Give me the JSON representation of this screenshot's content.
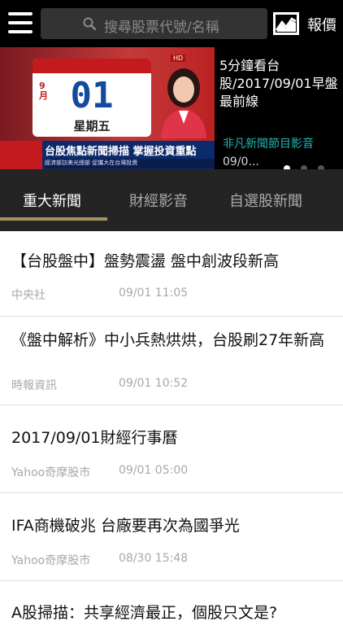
{
  "header": {
    "search_placeholder": "搜尋股票代號/名稱",
    "quote_label": "報價",
    "icons": {
      "menu": "hamburger-menu-icon",
      "search": "magnifier-search-icon",
      "quote": "stock-chart-icon"
    }
  },
  "banner": {
    "title": "5分鐘看台股/2017/09/01早盤最前線",
    "source": "非凡新聞節目影音",
    "date": "09/0...",
    "thumbnail": {
      "calendar_month": "9月",
      "calendar_day": "01",
      "calendar_weekday": "星期五",
      "ticker_headline": "台股焦點新聞掃描 掌握投資重點",
      "ticker_sub": "經濟部訪美光總部 促攜大在台灣投資"
    },
    "slides": 3,
    "active_slide": 1
  },
  "tabs": [
    {
      "label": "重大新聞",
      "active": true
    },
    {
      "label": "財經影音",
      "active": false
    },
    {
      "label": "自選股新聞",
      "active": false
    }
  ],
  "news": [
    {
      "title": "【台股盤中】盤勢震盪 盤中創波段新高",
      "source": "中央社",
      "time": "09/01 11:05"
    },
    {
      "title": "《盤中解析》中小兵熱烘烘，台股刷27年新高",
      "source": "時報資訊",
      "time": "09/01 10:52"
    },
    {
      "title": "2017/09/01財經行事曆",
      "source": "Yahoo奇摩股市",
      "time": "09/01 05:00"
    },
    {
      "title": "IFA商機破兆 台廠要再次為國爭光",
      "source": "Yahoo奇摩股市",
      "time": "08/30 15:48"
    },
    {
      "title": "A股掃描：共享經濟最正，個股只文是?",
      "source": "",
      "time": ""
    }
  ],
  "colors": {
    "tab_indicator": "#a7925c",
    "source_teal": "#1bb6b0",
    "header_bg": "#000000",
    "tabs_bg": "#242424"
  }
}
